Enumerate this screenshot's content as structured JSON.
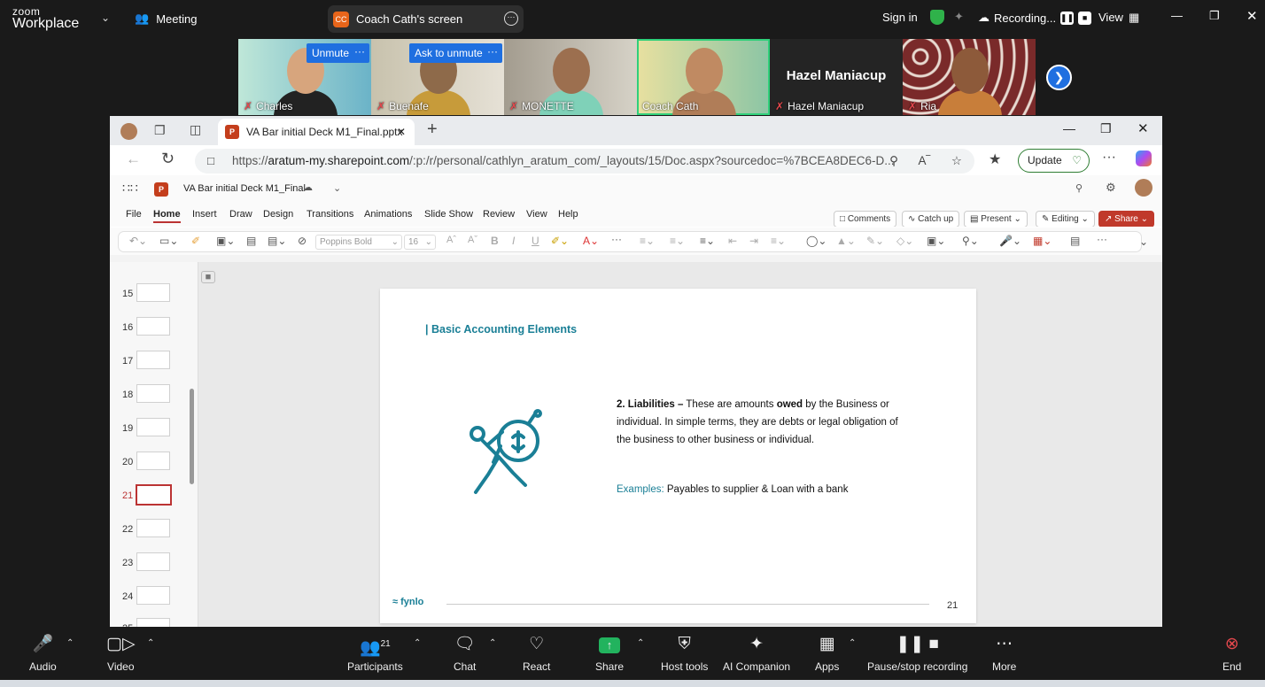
{
  "zoom": {
    "logo_top": "zoom",
    "logo_bottom": "Workplace",
    "meeting_label": "Meeting",
    "share_initials": "CC",
    "share_label": "Coach Cath's screen",
    "sign_in": "Sign in",
    "recording": "Recording...",
    "view": "View"
  },
  "gallery": [
    {
      "name": "Charles",
      "button": "Unmute"
    },
    {
      "name": "Buenafe",
      "button": "Ask to unmute"
    },
    {
      "name": "MONETTE"
    },
    {
      "name": "Coach Cath"
    },
    {
      "name": "Hazel Maniacup",
      "title": "Hazel Maniacup"
    },
    {
      "name": "Ria"
    }
  ],
  "browser": {
    "tab_title": "VA Bar initial Deck M1_Final.pptx",
    "url_prefix": "https://",
    "url_host": "aratum-my.sharepoint.com",
    "url_path": "/:p:/r/personal/cathlyn_aratum_com/_layouts/15/Doc.aspx?sourcedoc=%7BCEA8DEC6-D...",
    "update_label": "Update"
  },
  "ppt": {
    "file_name": "VA Bar initial Deck M1_Final",
    "menu": [
      "File",
      "Home",
      "Insert",
      "Draw",
      "Design",
      "Transitions",
      "Animations",
      "Slide Show",
      "Review",
      "View",
      "Help"
    ],
    "comments": "Comments",
    "catchup": "Catch up",
    "present": "Present",
    "editing": "Editing",
    "share": "Share",
    "font_name": "Poppins Bold",
    "font_size": "16",
    "thumbnails": [
      "15",
      "16",
      "17",
      "18",
      "19",
      "20",
      "21",
      "22",
      "23",
      "24",
      "25"
    ],
    "selected_slide": "21"
  },
  "slide": {
    "title": "| Basic Accounting Elements",
    "liab_heading": "2. Liabilities –",
    "liab_t1": " These are amounts ",
    "liab_bold": "owed",
    "liab_t2": " by the Business or individual. In simple terms, they are debts or legal obligation of the business to other business or individual.",
    "examples_key": "Examples:",
    "examples_text": " Payables to supplier & Loan with a bank",
    "brand": "fynlo",
    "page_number": "21"
  },
  "toolbar": {
    "audio": "Audio",
    "video": "Video",
    "participants": "Participants",
    "participants_count": "21",
    "chat": "Chat",
    "react": "React",
    "share": "Share",
    "host_tools": "Host tools",
    "ai": "AI Companion",
    "apps": "Apps",
    "pause": "Pause/stop recording",
    "more": "More",
    "end": "End"
  }
}
